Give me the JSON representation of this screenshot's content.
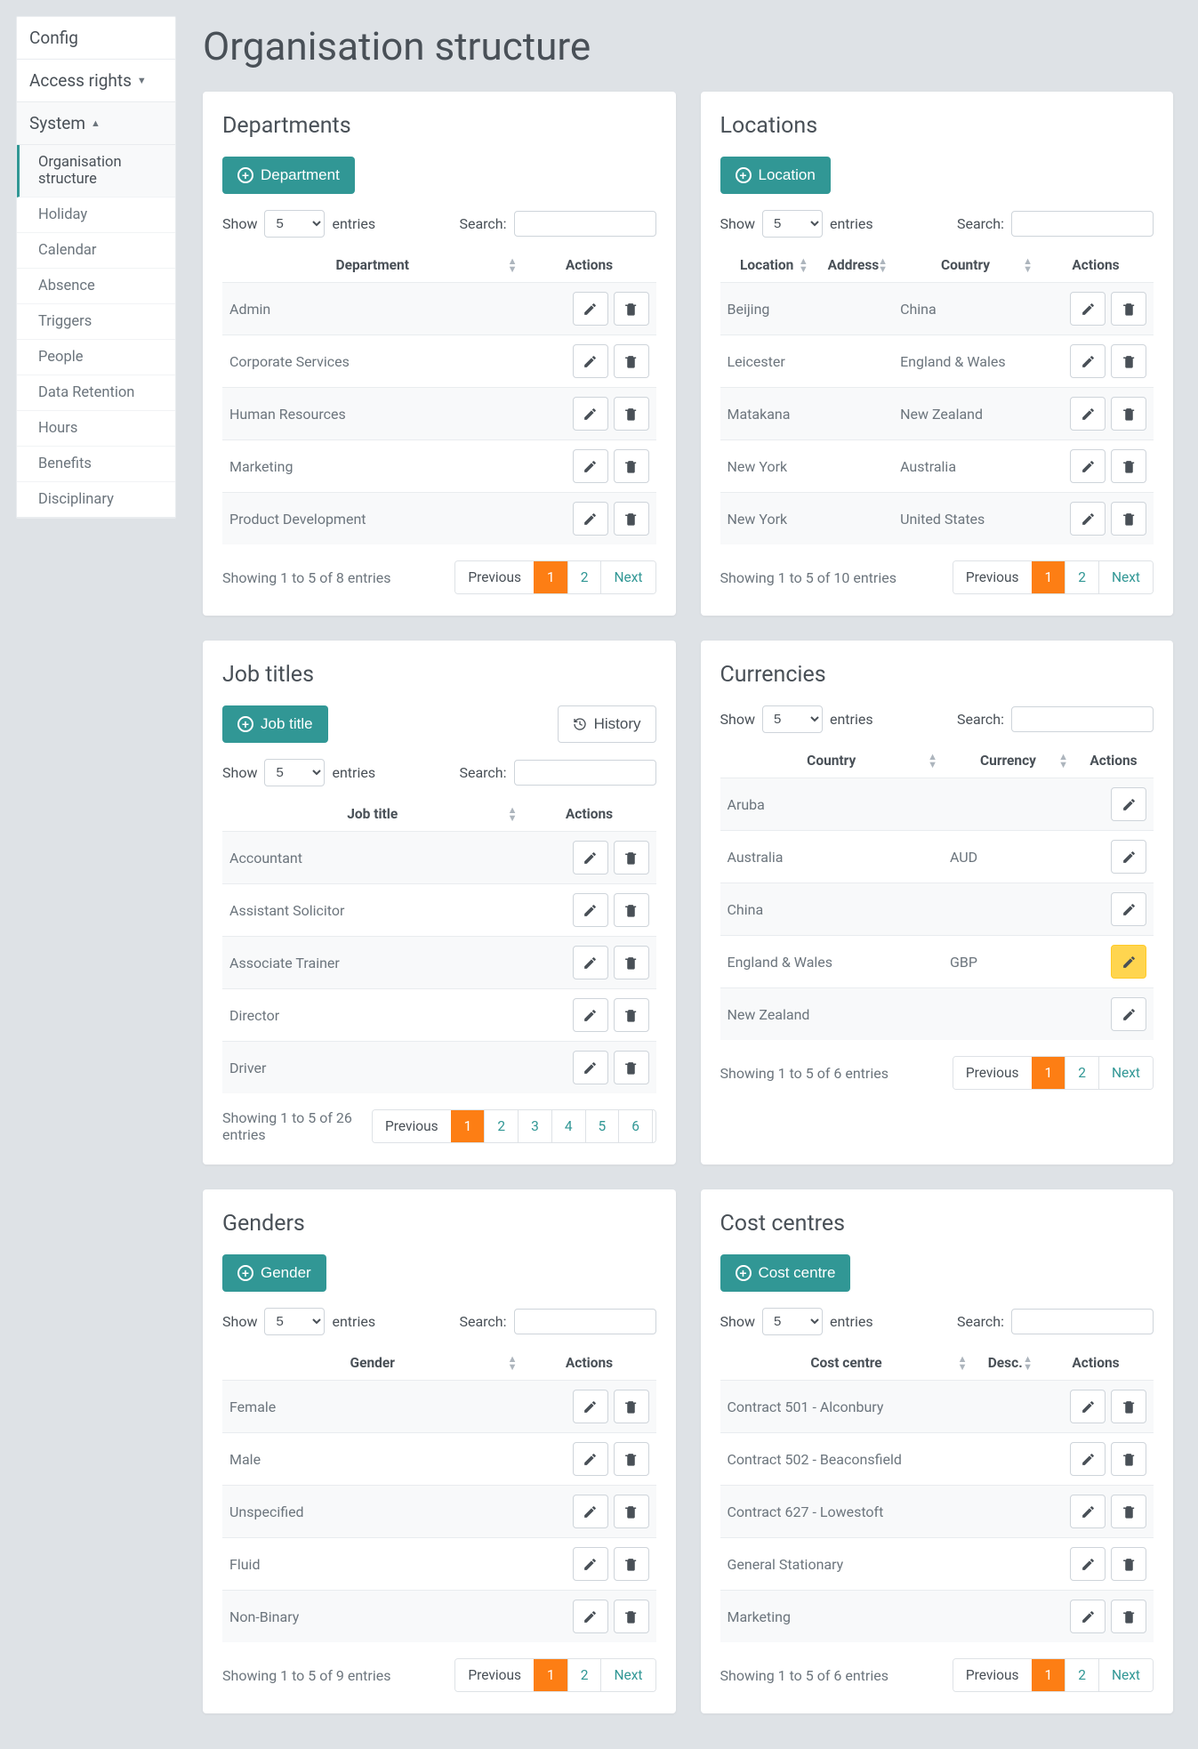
{
  "sidebar": {
    "config_label": "Config",
    "access_rights_label": "Access rights",
    "system_label": "System",
    "items": [
      "Organisation structure",
      "Holiday",
      "Calendar",
      "Absence",
      "Triggers",
      "People",
      "Data Retention",
      "Hours",
      "Benefits",
      "Disciplinary"
    ]
  },
  "page_title": "Organisation structure",
  "common": {
    "show_label": "Show",
    "entries_label": "entries",
    "search_label": "Search:",
    "page_size": "5",
    "actions_label": "Actions",
    "prev_label": "Previous",
    "next_label": "Next"
  },
  "departments": {
    "title": "Departments",
    "add_label": "Department",
    "col": "Department",
    "rows": [
      "Admin",
      "Corporate Services",
      "Human Resources",
      "Marketing",
      "Product Development"
    ],
    "info": "Showing 1 to 5 of 8 entries",
    "pages": [
      "1",
      "2"
    ]
  },
  "locations": {
    "title": "Locations",
    "add_label": "Location",
    "cols": {
      "location": "Location",
      "address": "Address",
      "country": "Country"
    },
    "rows": [
      {
        "loc": "Beijing",
        "addr": "",
        "country": "China"
      },
      {
        "loc": "Leicester",
        "addr": "",
        "country": "England & Wales"
      },
      {
        "loc": "Matakana",
        "addr": "",
        "country": "New Zealand"
      },
      {
        "loc": "New York",
        "addr": "",
        "country": "Australia"
      },
      {
        "loc": "New York",
        "addr": "",
        "country": "United States"
      }
    ],
    "info": "Showing 1 to 5 of 10 entries",
    "pages": [
      "1",
      "2"
    ]
  },
  "jobtitles": {
    "title": "Job titles",
    "add_label": "Job title",
    "history_label": "History",
    "col": "Job title",
    "rows": [
      "Accountant",
      "Assistant Solicitor",
      "Associate Trainer",
      "Director",
      "Driver"
    ],
    "info": "Showing 1 to 5 of 26 entries",
    "pages": [
      "1",
      "2",
      "3",
      "4",
      "5",
      "6"
    ]
  },
  "currencies": {
    "title": "Currencies",
    "cols": {
      "country": "Country",
      "currency": "Currency"
    },
    "rows": [
      {
        "country": "Aruba",
        "currency": "",
        "hl": false
      },
      {
        "country": "Australia",
        "currency": "AUD",
        "hl": false
      },
      {
        "country": "China",
        "currency": "",
        "hl": false
      },
      {
        "country": "England & Wales",
        "currency": "GBP",
        "hl": true
      },
      {
        "country": "New Zealand",
        "currency": "",
        "hl": false
      }
    ],
    "info": "Showing 1 to 5 of 6 entries",
    "pages": [
      "1",
      "2"
    ]
  },
  "genders": {
    "title": "Genders",
    "add_label": "Gender",
    "col": "Gender",
    "rows": [
      "Female",
      "Male",
      "Unspecified",
      "Fluid",
      "Non-Binary"
    ],
    "info": "Showing 1 to 5 of 9 entries",
    "pages": [
      "1",
      "2"
    ]
  },
  "costcentres": {
    "title": "Cost centres",
    "add_label": "Cost centre",
    "cols": {
      "cc": "Cost centre",
      "desc": "Desc."
    },
    "rows": [
      {
        "cc": "Contract 501 - Alconbury",
        "desc": ""
      },
      {
        "cc": "Contract 502 - Beaconsfield",
        "desc": ""
      },
      {
        "cc": "Contract 627 - Lowestoft",
        "desc": ""
      },
      {
        "cc": "General Stationary",
        "desc": ""
      },
      {
        "cc": "Marketing",
        "desc": ""
      }
    ],
    "info": "Showing 1 to 5 of 6 entries",
    "pages": [
      "1",
      "2"
    ]
  }
}
